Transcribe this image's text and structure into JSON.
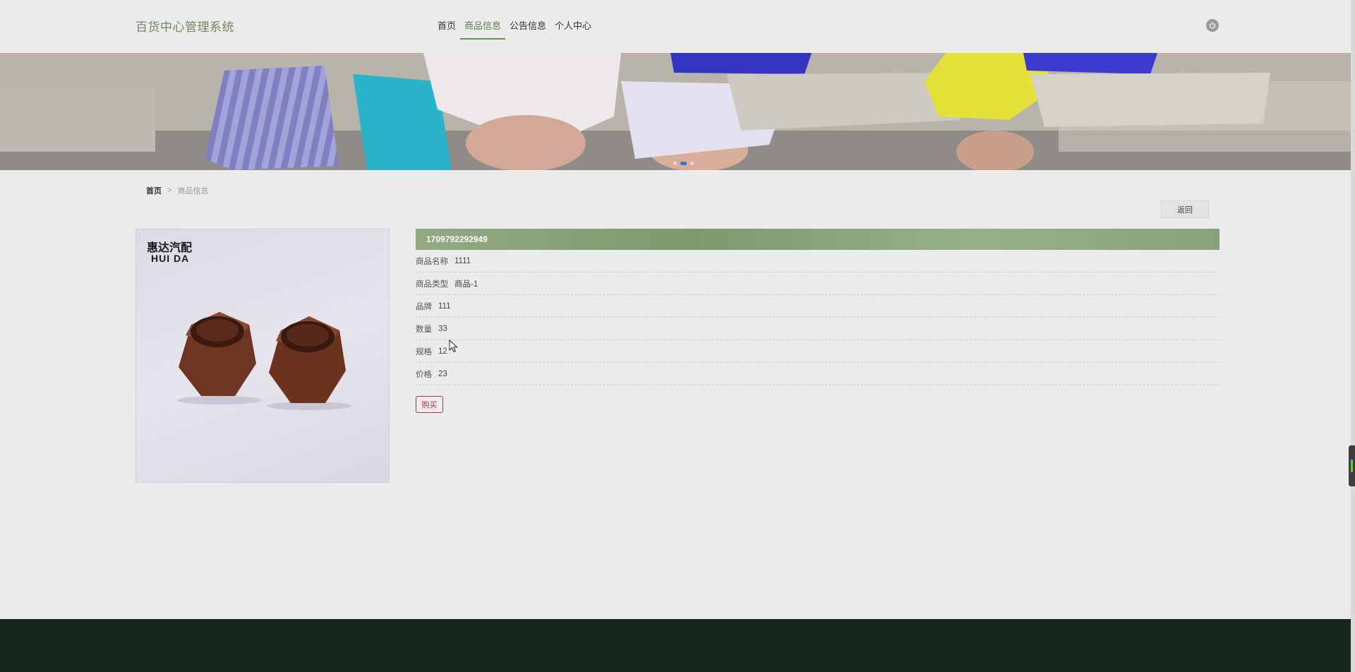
{
  "header": {
    "site_title": "百货中心管理系统",
    "nav": [
      {
        "label": "首页",
        "active": false
      },
      {
        "label": "商品信息",
        "active": true
      },
      {
        "label": "公告信息",
        "active": false
      },
      {
        "label": "个人中心",
        "active": false
      }
    ],
    "power_icon": "power-icon"
  },
  "banner": {
    "slide_count": 3,
    "active_slide": 2
  },
  "breadcrumb": {
    "home": "首页",
    "separator": ">",
    "current": "商品信息"
  },
  "back_label": "返回",
  "product": {
    "image_brand_cn": "惠达汽配",
    "image_brand_en": "HUI DA",
    "code": "1709792292949",
    "fields": [
      {
        "label": "商品名称",
        "value": "1111"
      },
      {
        "label": "商品类型",
        "value": "商品-1"
      },
      {
        "label": "品牌",
        "value": "111"
      },
      {
        "label": "数量",
        "value": "33"
      },
      {
        "label": "规格",
        "value": "12"
      },
      {
        "label": "价格",
        "value": "23"
      }
    ],
    "buy_label": "购买"
  },
  "colors": {
    "accent": "#6d8a5c",
    "detail_header": "#8ba37c",
    "buy_border": "#a43a3a",
    "footer": "#17291f"
  }
}
